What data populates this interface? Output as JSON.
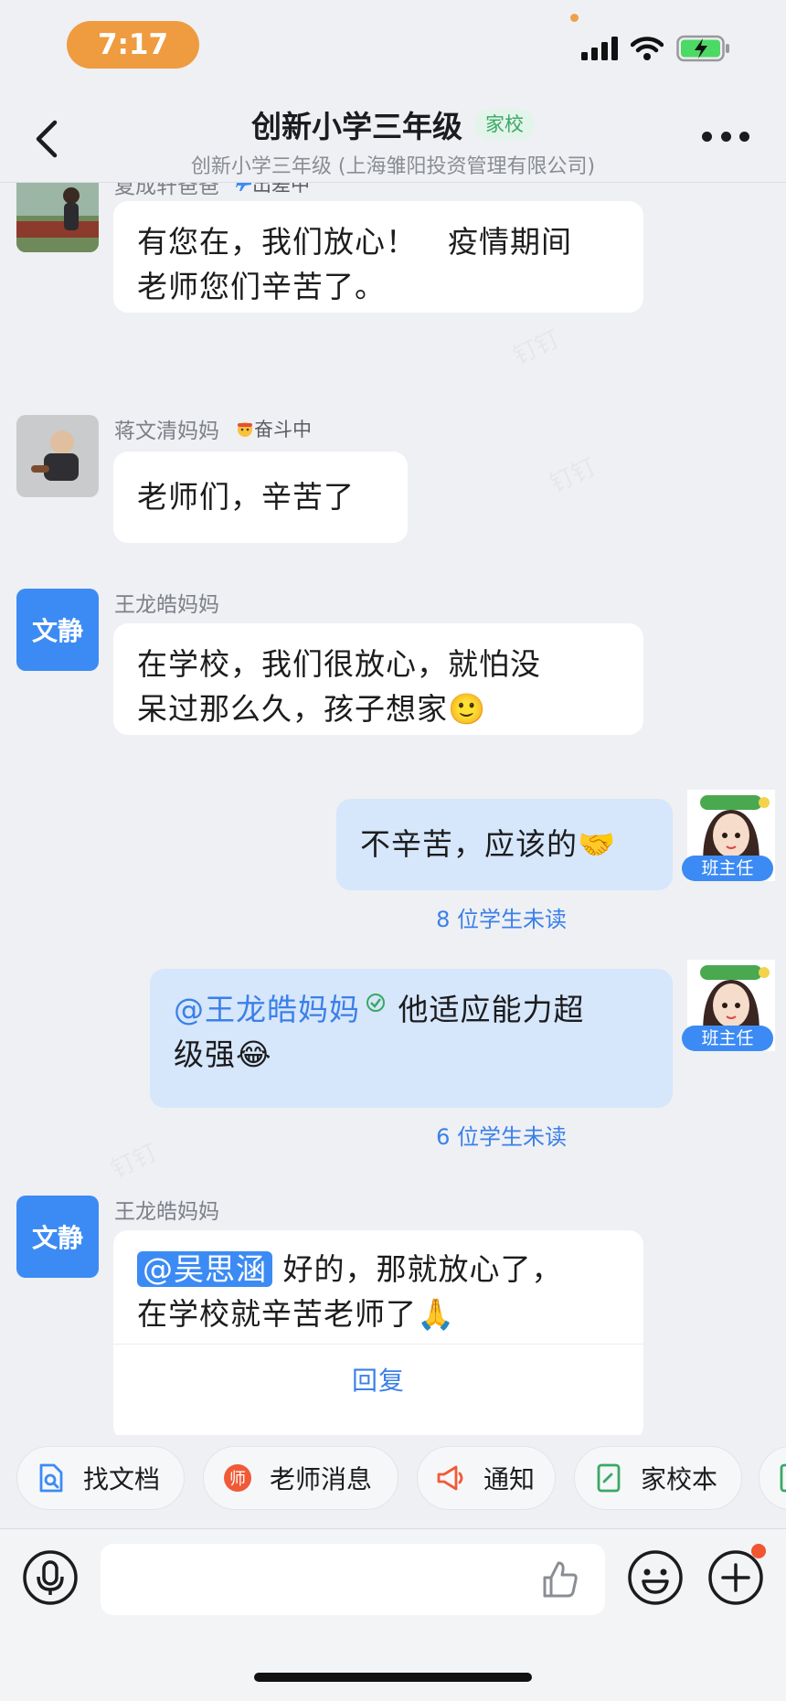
{
  "status_bar": {
    "time": "7:17"
  },
  "header": {
    "title": "创新小学三年级",
    "tag": "家校",
    "subtitle": "创新小学三年级 (上海雏阳投资管理有限公司)"
  },
  "messages": [
    {
      "sender": "夏成轩爸爸",
      "status": "出差中",
      "lines": [
        "有您在，我们放心！　疫情期间",
        "老师您们辛苦了。"
      ]
    },
    {
      "sender": "蒋文清妈妈",
      "status": "奋斗中",
      "lines": [
        "老师们，辛苦了"
      ]
    },
    {
      "sender": "王龙皓妈妈",
      "avatar_text": "文静",
      "lines": [
        "在学校，我们很放心，就怕没",
        "呆过那么久，孩子想家🙂"
      ]
    },
    {
      "sender_role": "班主任",
      "text": "不辛苦，应该的🤝",
      "unread": "8 位学生未读"
    },
    {
      "sender_role": "班主任",
      "mention": "@王龙皓妈妈",
      "line1_rest": " 他适应能力超",
      "line2": "级强😂",
      "unread": "6 位学生未读"
    },
    {
      "sender": "王龙皓妈妈",
      "avatar_text": "文静",
      "mention": "@吴思涵",
      "line1_rest": "好的，那就放心了，",
      "line2": "在学校就辛苦老师了🙏",
      "reply_label": "回复"
    }
  ],
  "quick_actions": [
    {
      "label": "找文档",
      "icon": "doc-search-icon"
    },
    {
      "label": "老师消息",
      "icon": "teacher-message-icon"
    },
    {
      "label": "通知",
      "icon": "megaphone-icon"
    },
    {
      "label": "家校本",
      "icon": "notebook-icon"
    }
  ],
  "colors": {
    "accent": "#3c8bf4",
    "time_pill": "#ef9b3f",
    "tag_green": "#3aa865"
  }
}
